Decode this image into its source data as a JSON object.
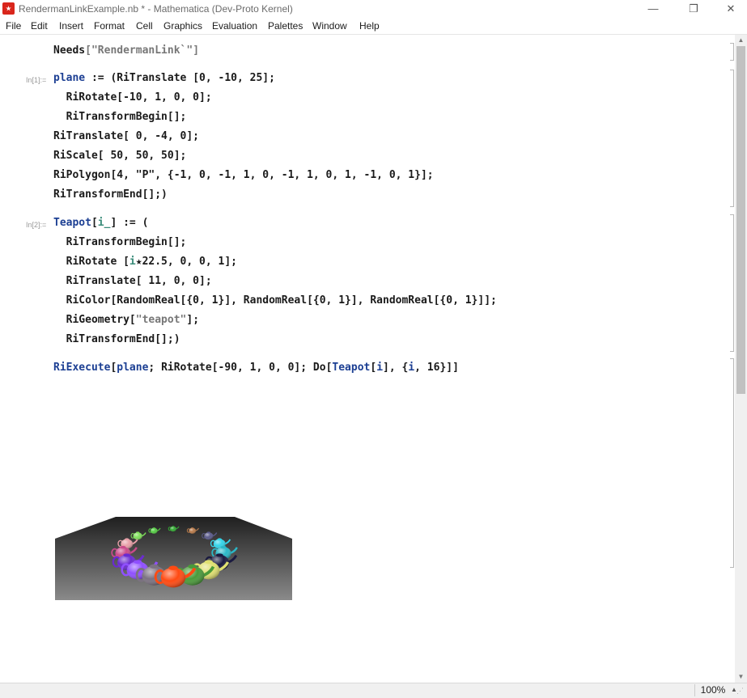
{
  "window": {
    "title": "RendermanLinkExample.nb * - Mathematica (Dev-Proto Kernel)",
    "minimize": "—",
    "maximize": "❐",
    "close": "✕"
  },
  "menu": [
    "File",
    "Edit",
    "Insert",
    "Format",
    "Cell",
    "Graphics",
    "Evaluation",
    "Palettes",
    "Window",
    "Help"
  ],
  "cells": {
    "needs": {
      "prefix": "Needs",
      "arg": "[\"RendermanLink`\"]"
    },
    "in1": {
      "label": "In[1]:=",
      "lines": [
        [
          "plane",
          " := (RiTranslate [0, -10, 25];"
        ],
        [
          "",
          "  RiRotate[-10, 1, 0, 0];"
        ],
        [
          "",
          "  RiTransformBegin[];"
        ],
        [
          "",
          "RiTranslate[ 0, -4, 0];"
        ],
        [
          "",
          "RiScale[ 50, 50, 50];"
        ],
        [
          "",
          "RiPolygon[4, \"P\", {-1, 0, -1, 1, 0, -1, 1, 0, 1, -1, 0, 1}];"
        ],
        [
          "",
          "RiTransformEnd[];)"
        ]
      ]
    },
    "in2": {
      "label": "In[2]:=",
      "head": "Teapot",
      "head_rest": "[",
      "head_arg": "i_",
      "head_tail": "] := (",
      "lines": [
        "  RiTransformBegin[];",
        "  RiRotate [",
        "  RiTranslate[ 11, 0, 0];",
        "  RiColor[RandomReal[{0, 1}], RandomReal[{0, 1}], RandomReal[{0, 1}]];",
        "  RiGeometry[",
        "  RiTransformEnd[];)"
      ],
      "rotate_var": "i",
      "rotate_rest": "★22.5, 0, 0, 1];",
      "geometry_str": "\"teapot\"",
      "geometry_tail": "];"
    },
    "execute": {
      "f1": "RiExecute",
      "p1": "[",
      "v1": "plane",
      "p2": "; RiRotate[-90, 1, 0, 0]; Do[",
      "f2": "Teapot",
      "p3": "[",
      "v2": "i",
      "p4": "], {",
      "v3": "i",
      "p5": ", 16}]]"
    }
  },
  "render": {
    "teapot_count": 16,
    "teapot_colors": [
      "#ff4a12",
      "#7b7280",
      "#8f4fff",
      "#6a2bd0",
      "#c94a8a",
      "#e8a0a8",
      "#7fe05a",
      "#55cc44",
      "#33aa33",
      "#b87a4a",
      "#5a5a8a",
      "#33d4e8",
      "#2ab8c8",
      "#1a1a40",
      "#e0e070",
      "#4a9a3a"
    ]
  },
  "status": {
    "zoom": "100%",
    "zoom_arrow": "▲",
    "grip": "⋰"
  },
  "scrollbar": {
    "up": "▲",
    "down": "▼"
  }
}
